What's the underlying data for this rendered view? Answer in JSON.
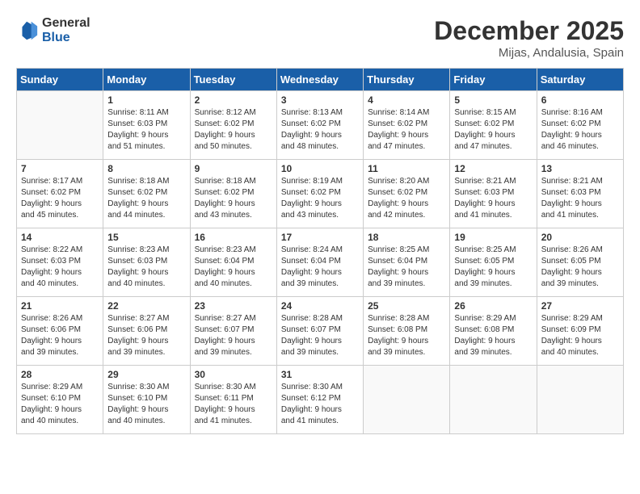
{
  "logo": {
    "line1": "General",
    "line2": "Blue"
  },
  "title": "December 2025",
  "subtitle": "Mijas, Andalusia, Spain",
  "days_header": [
    "Sunday",
    "Monday",
    "Tuesday",
    "Wednesday",
    "Thursday",
    "Friday",
    "Saturday"
  ],
  "weeks": [
    [
      {
        "num": "",
        "info": ""
      },
      {
        "num": "1",
        "info": "Sunrise: 8:11 AM\nSunset: 6:03 PM\nDaylight: 9 hours\nand 51 minutes."
      },
      {
        "num": "2",
        "info": "Sunrise: 8:12 AM\nSunset: 6:02 PM\nDaylight: 9 hours\nand 50 minutes."
      },
      {
        "num": "3",
        "info": "Sunrise: 8:13 AM\nSunset: 6:02 PM\nDaylight: 9 hours\nand 48 minutes."
      },
      {
        "num": "4",
        "info": "Sunrise: 8:14 AM\nSunset: 6:02 PM\nDaylight: 9 hours\nand 47 minutes."
      },
      {
        "num": "5",
        "info": "Sunrise: 8:15 AM\nSunset: 6:02 PM\nDaylight: 9 hours\nand 47 minutes."
      },
      {
        "num": "6",
        "info": "Sunrise: 8:16 AM\nSunset: 6:02 PM\nDaylight: 9 hours\nand 46 minutes."
      }
    ],
    [
      {
        "num": "7",
        "info": "Sunrise: 8:17 AM\nSunset: 6:02 PM\nDaylight: 9 hours\nand 45 minutes."
      },
      {
        "num": "8",
        "info": "Sunrise: 8:18 AM\nSunset: 6:02 PM\nDaylight: 9 hours\nand 44 minutes."
      },
      {
        "num": "9",
        "info": "Sunrise: 8:18 AM\nSunset: 6:02 PM\nDaylight: 9 hours\nand 43 minutes."
      },
      {
        "num": "10",
        "info": "Sunrise: 8:19 AM\nSunset: 6:02 PM\nDaylight: 9 hours\nand 43 minutes."
      },
      {
        "num": "11",
        "info": "Sunrise: 8:20 AM\nSunset: 6:02 PM\nDaylight: 9 hours\nand 42 minutes."
      },
      {
        "num": "12",
        "info": "Sunrise: 8:21 AM\nSunset: 6:03 PM\nDaylight: 9 hours\nand 41 minutes."
      },
      {
        "num": "13",
        "info": "Sunrise: 8:21 AM\nSunset: 6:03 PM\nDaylight: 9 hours\nand 41 minutes."
      }
    ],
    [
      {
        "num": "14",
        "info": "Sunrise: 8:22 AM\nSunset: 6:03 PM\nDaylight: 9 hours\nand 40 minutes."
      },
      {
        "num": "15",
        "info": "Sunrise: 8:23 AM\nSunset: 6:03 PM\nDaylight: 9 hours\nand 40 minutes."
      },
      {
        "num": "16",
        "info": "Sunrise: 8:23 AM\nSunset: 6:04 PM\nDaylight: 9 hours\nand 40 minutes."
      },
      {
        "num": "17",
        "info": "Sunrise: 8:24 AM\nSunset: 6:04 PM\nDaylight: 9 hours\nand 39 minutes."
      },
      {
        "num": "18",
        "info": "Sunrise: 8:25 AM\nSunset: 6:04 PM\nDaylight: 9 hours\nand 39 minutes."
      },
      {
        "num": "19",
        "info": "Sunrise: 8:25 AM\nSunset: 6:05 PM\nDaylight: 9 hours\nand 39 minutes."
      },
      {
        "num": "20",
        "info": "Sunrise: 8:26 AM\nSunset: 6:05 PM\nDaylight: 9 hours\nand 39 minutes."
      }
    ],
    [
      {
        "num": "21",
        "info": "Sunrise: 8:26 AM\nSunset: 6:06 PM\nDaylight: 9 hours\nand 39 minutes."
      },
      {
        "num": "22",
        "info": "Sunrise: 8:27 AM\nSunset: 6:06 PM\nDaylight: 9 hours\nand 39 minutes."
      },
      {
        "num": "23",
        "info": "Sunrise: 8:27 AM\nSunset: 6:07 PM\nDaylight: 9 hours\nand 39 minutes."
      },
      {
        "num": "24",
        "info": "Sunrise: 8:28 AM\nSunset: 6:07 PM\nDaylight: 9 hours\nand 39 minutes."
      },
      {
        "num": "25",
        "info": "Sunrise: 8:28 AM\nSunset: 6:08 PM\nDaylight: 9 hours\nand 39 minutes."
      },
      {
        "num": "26",
        "info": "Sunrise: 8:29 AM\nSunset: 6:08 PM\nDaylight: 9 hours\nand 39 minutes."
      },
      {
        "num": "27",
        "info": "Sunrise: 8:29 AM\nSunset: 6:09 PM\nDaylight: 9 hours\nand 40 minutes."
      }
    ],
    [
      {
        "num": "28",
        "info": "Sunrise: 8:29 AM\nSunset: 6:10 PM\nDaylight: 9 hours\nand 40 minutes."
      },
      {
        "num": "29",
        "info": "Sunrise: 8:30 AM\nSunset: 6:10 PM\nDaylight: 9 hours\nand 40 minutes."
      },
      {
        "num": "30",
        "info": "Sunrise: 8:30 AM\nSunset: 6:11 PM\nDaylight: 9 hours\nand 41 minutes."
      },
      {
        "num": "31",
        "info": "Sunrise: 8:30 AM\nSunset: 6:12 PM\nDaylight: 9 hours\nand 41 minutes."
      },
      {
        "num": "",
        "info": ""
      },
      {
        "num": "",
        "info": ""
      },
      {
        "num": "",
        "info": ""
      }
    ]
  ]
}
